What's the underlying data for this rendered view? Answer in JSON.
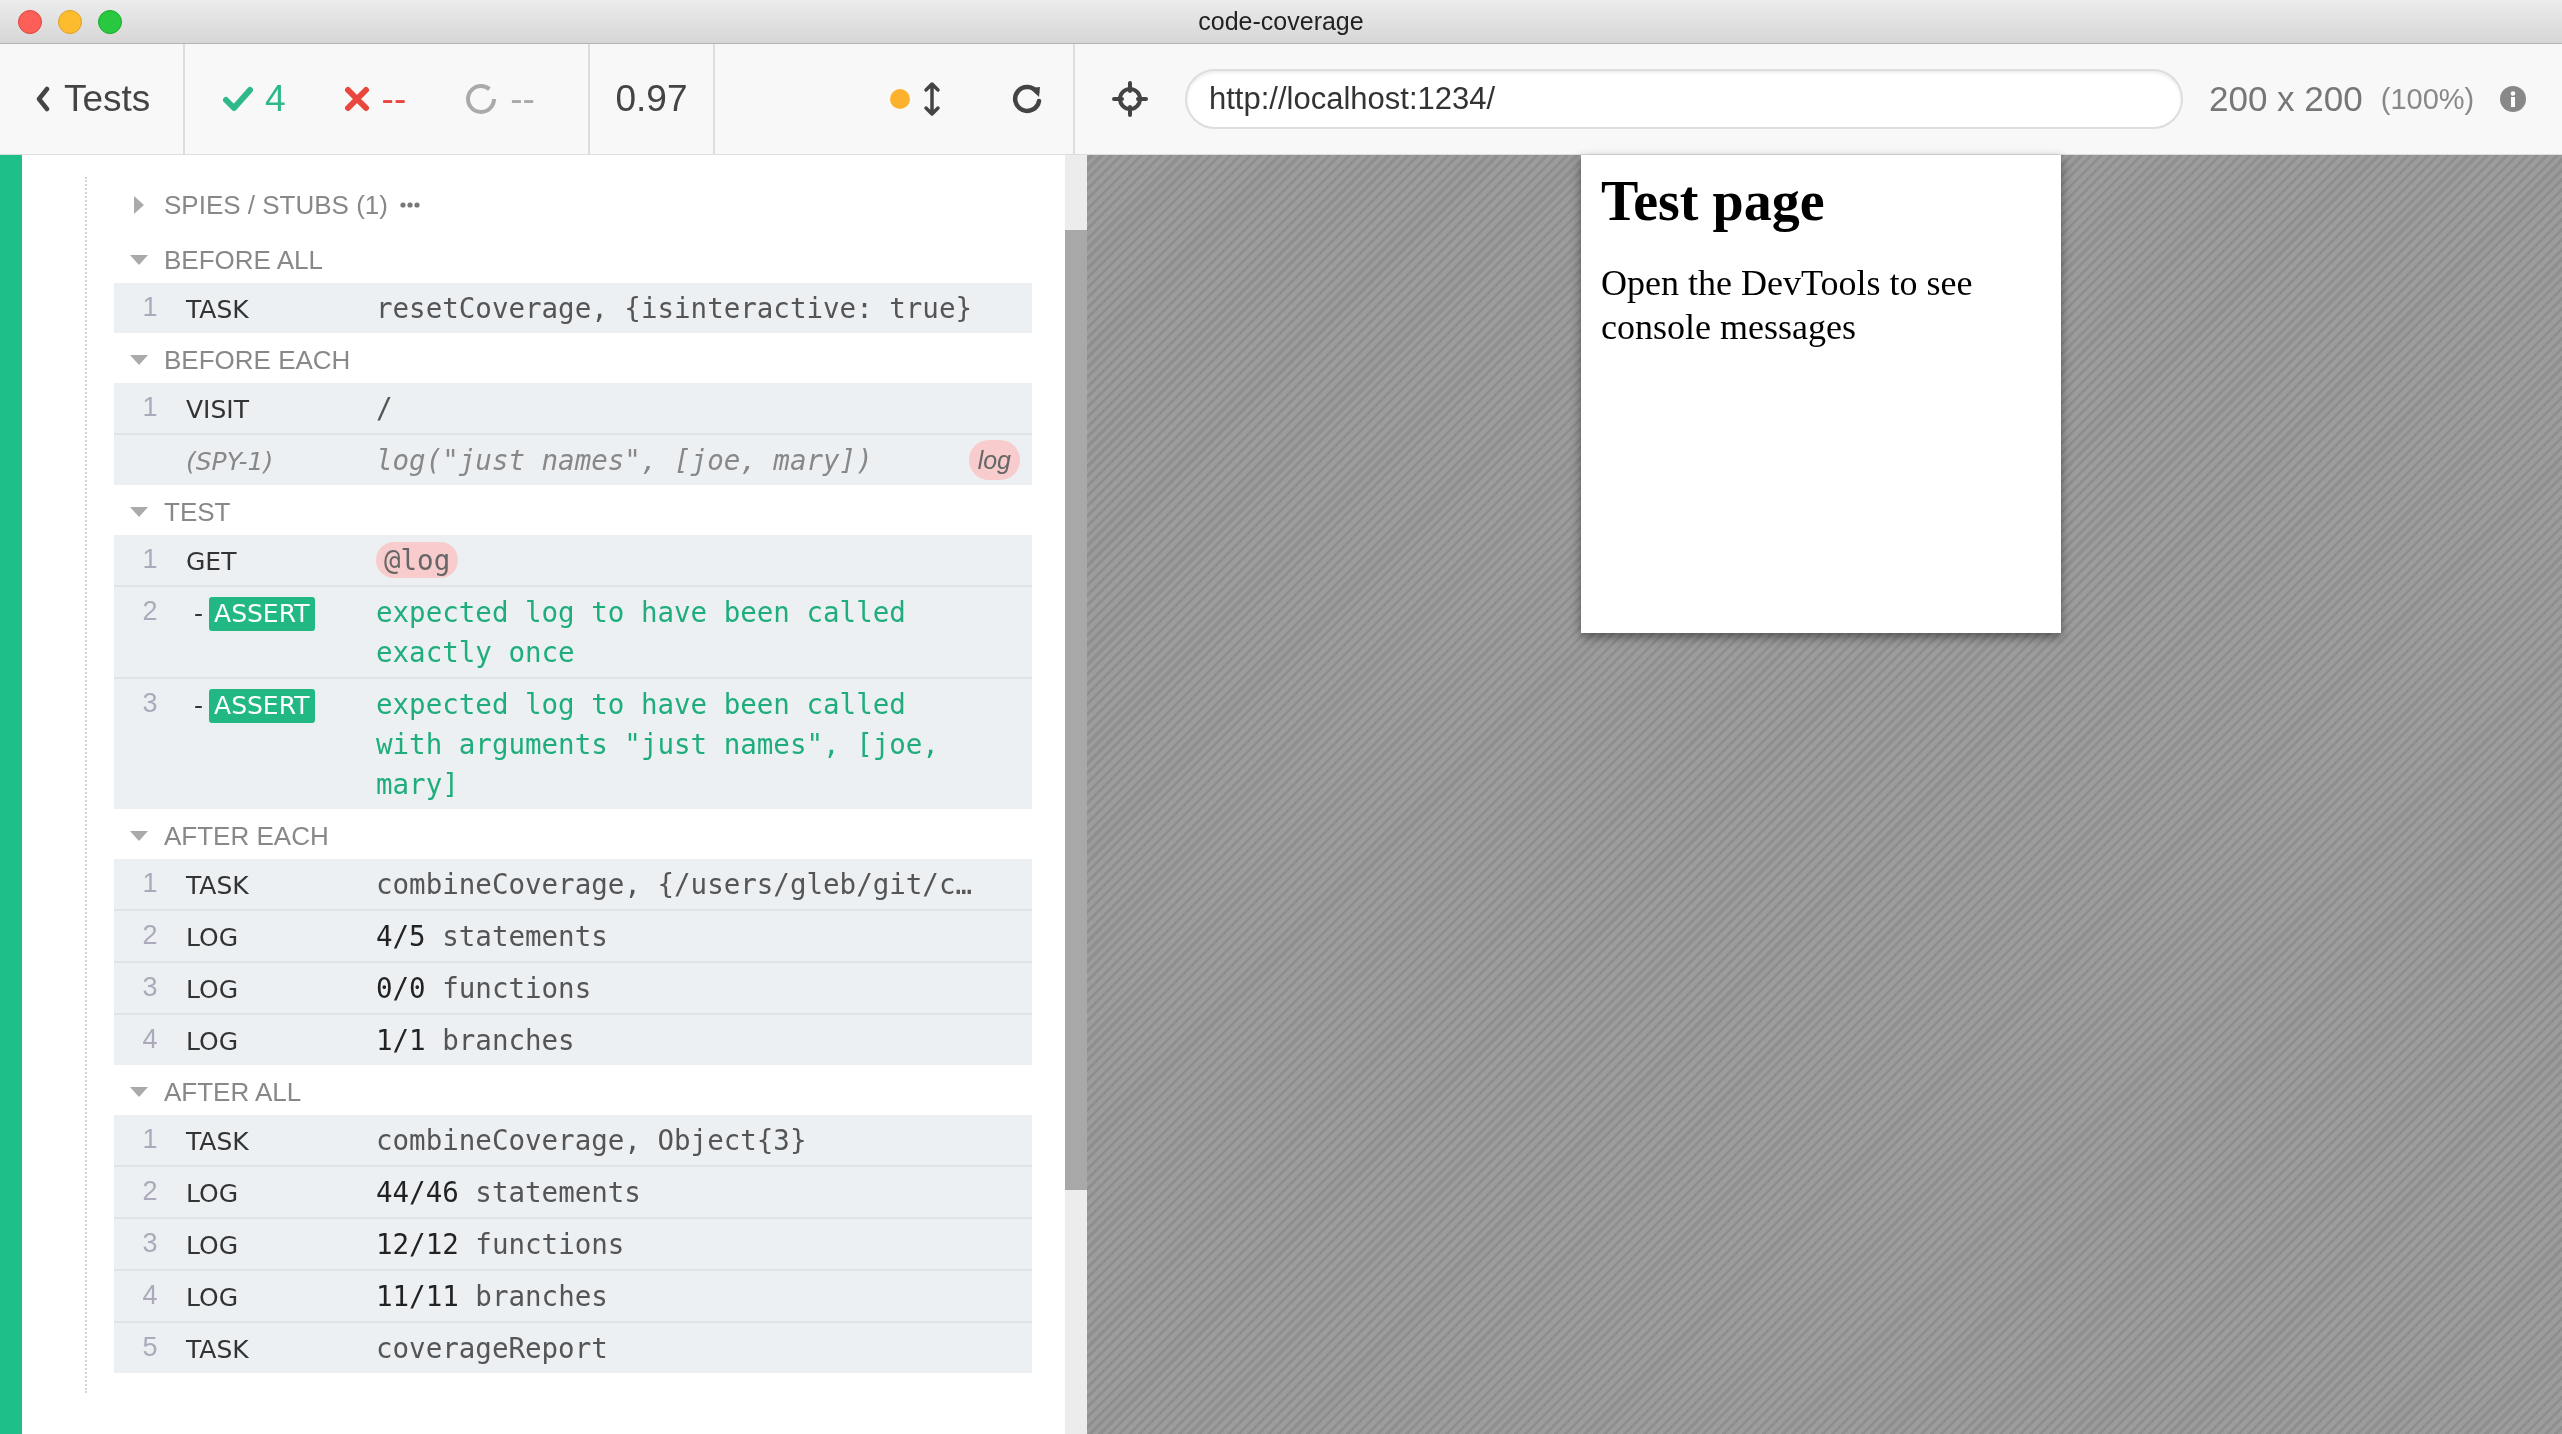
{
  "window": {
    "title": "code-coverage"
  },
  "toolbar": {
    "back_label": "Tests",
    "passed": "4",
    "failed": "--",
    "pending": "--",
    "duration": "0.97",
    "url": "http://localhost:1234/",
    "viewport": "200 x 200",
    "scale": "(100%)"
  },
  "reporter": {
    "passed": true,
    "spies": {
      "label": "SPIES / STUBS (1)",
      "expanded": false
    },
    "hooks": [
      {
        "title": "BEFORE ALL",
        "expanded": true,
        "commands": [
          {
            "kind": "command",
            "number": "1",
            "name": "TASK",
            "message": "resetCoverage, {isinteractive: true}"
          }
        ]
      },
      {
        "title": "BEFORE EACH",
        "expanded": true,
        "commands": [
          {
            "kind": "command",
            "number": "1",
            "name": "VISIT",
            "message": "/"
          },
          {
            "kind": "spy",
            "name": "(SPY-1)",
            "message": "log(\"just names\", [joe, mary])",
            "badge": "log"
          }
        ]
      },
      {
        "title": "TEST",
        "expanded": true,
        "commands": [
          {
            "kind": "alias",
            "number": "1",
            "name": "GET",
            "message": "@log"
          },
          {
            "kind": "assert",
            "number": "2",
            "prefix": "-",
            "name": "ASSERT",
            "message": "expected log to have been called exactly once"
          },
          {
            "kind": "assert",
            "number": "3",
            "prefix": "-",
            "name": "ASSERT",
            "message": "expected log to have been called with arguments \"just names\", [joe, mary]"
          }
        ]
      },
      {
        "title": "AFTER EACH",
        "expanded": true,
        "commands": [
          {
            "kind": "command",
            "number": "1",
            "name": "TASK",
            "message": "combineCoverage, {/users/gleb/git/c…"
          },
          {
            "kind": "command",
            "number": "2",
            "name": "LOG",
            "message": "**4/5** statements"
          },
          {
            "kind": "command",
            "number": "3",
            "name": "LOG",
            "message": "**0/0** functions"
          },
          {
            "kind": "command",
            "number": "4",
            "name": "LOG",
            "message": "**1/1** branches"
          }
        ]
      },
      {
        "title": "AFTER ALL",
        "expanded": true,
        "commands": [
          {
            "kind": "command",
            "number": "1",
            "name": "TASK",
            "message": "combineCoverage, Object{3}"
          },
          {
            "kind": "command",
            "number": "2",
            "name": "LOG",
            "message": "**44/46** statements"
          },
          {
            "kind": "command",
            "number": "3",
            "name": "LOG",
            "message": "**12/12** functions"
          },
          {
            "kind": "command",
            "number": "4",
            "name": "LOG",
            "message": "**11/11** branches"
          },
          {
            "kind": "command",
            "number": "5",
            "name": "TASK",
            "message": "coverageReport"
          }
        ]
      }
    ]
  },
  "preview": {
    "heading": "Test page",
    "text": "Open the DevTools to see console messages"
  }
}
